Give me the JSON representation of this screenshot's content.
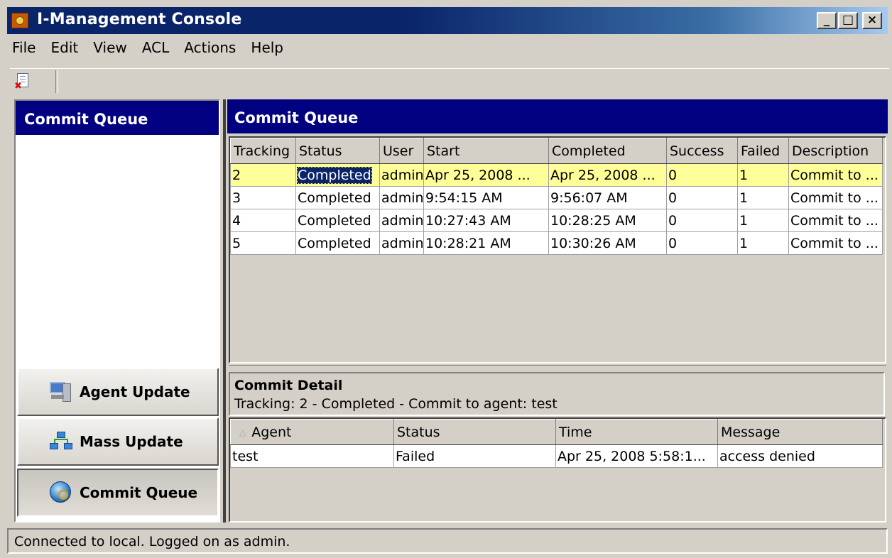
{
  "window": {
    "title": "I-Management Console",
    "controls": {
      "minimize": "_",
      "maximize": "□",
      "close": "×"
    }
  },
  "menu": [
    "File",
    "Edit",
    "View",
    "ACL",
    "Actions",
    "Help"
  ],
  "toolbar": {
    "icon": "delete-document-icon"
  },
  "left_panel": {
    "header": "Commit Queue",
    "nav_buttons": [
      {
        "label": "Agent Update",
        "icon": "agent-update-icon"
      },
      {
        "label": "Mass Update",
        "icon": "mass-update-icon"
      },
      {
        "label": "Commit Queue",
        "icon": "commit-queue-icon",
        "active": true
      }
    ]
  },
  "main": {
    "header": "Commit Queue",
    "queue_table": {
      "columns": [
        "Tracking",
        "Status",
        "User",
        "Start",
        "Completed",
        "Success",
        "Failed",
        "Description"
      ],
      "rows": [
        [
          "2",
          "Completed",
          "admin",
          "Apr 25, 2008 ...",
          "Apr 25, 2008 ...",
          "0",
          "1",
          "Commit to ..."
        ],
        [
          "3",
          "Completed",
          "admin",
          "9:54:15 AM",
          "9:56:07 AM",
          "0",
          "1",
          "Commit to ..."
        ],
        [
          "4",
          "Completed",
          "admin",
          "10:27:43 AM",
          "10:28:25 AM",
          "0",
          "1",
          "Commit to ..."
        ],
        [
          "5",
          "Completed",
          "admin",
          "10:28:21 AM",
          "10:30:26 AM",
          "0",
          "1",
          "Commit to ..."
        ]
      ],
      "selected_row": 0,
      "selected_color": "#ffff99"
    },
    "detail": {
      "title": "Commit Detail",
      "subtitle": "Tracking:  2 - Completed - Commit to agent: test",
      "table": {
        "columns": [
          "Agent",
          "Status",
          "Time",
          "Message"
        ],
        "sort_indicator": "△",
        "rows": [
          [
            "test",
            "Failed",
            "Apr 25, 2008 5:58:1...",
            "access denied"
          ]
        ]
      }
    }
  },
  "status_bar": {
    "text": "Connected to local.  Logged on as admin."
  },
  "colors": {
    "header_bg": "#000080",
    "face": "#d4d0c8",
    "title_gradient_start": "#0a246a"
  }
}
